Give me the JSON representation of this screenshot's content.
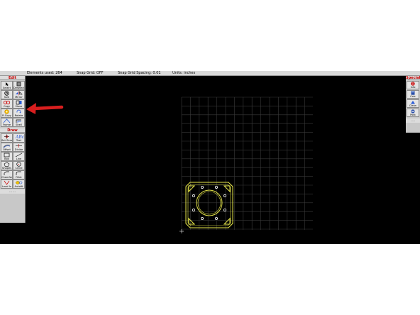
{
  "statusbar": {
    "elements_used": "Elements used: 264",
    "snap_grid": "Snap Grid: OFF",
    "snap_spacing": "Snap Grid Spacing: 0.01",
    "units": "Units: inches"
  },
  "left_toolbar": {
    "edit_header": "Edit",
    "draw_header": "Draw",
    "grip": "......",
    "edit_tools": [
      {
        "label": "Select",
        "icon": "cursor-icon"
      },
      {
        "label": "Deselect",
        "icon": "deselect-icon"
      },
      {
        "label": "Size",
        "icon": "size-icon"
      },
      {
        "label": "Mirror",
        "icon": "mirror-icon"
      },
      {
        "label": "Copy",
        "icon": "copy-icon"
      },
      {
        "label": "Move",
        "icon": "move-icon"
      },
      {
        "label": "R-Copy",
        "icon": "rotate-copy-icon"
      },
      {
        "label": "Rotate",
        "icon": "rotate-icon"
      },
      {
        "label": "Frame",
        "icon": "frame-icon"
      },
      {
        "label": "Shell",
        "icon": "shell-icon"
      }
    ],
    "draw_tools": [
      {
        "label": "Set Zero",
        "icon": "set-zero-icon"
      },
      {
        "label": "Text",
        "icon": "text-icon"
      },
      {
        "label": "Offset",
        "icon": "offset-icon"
      },
      {
        "label": "Divide",
        "icon": "divide-icon"
      },
      {
        "label": "Box",
        "icon": "box-icon"
      },
      {
        "label": "Line",
        "icon": "line-icon"
      },
      {
        "label": "Shapes",
        "icon": "shapes-icon"
      },
      {
        "label": "Circle",
        "icon": "circle-icon"
      },
      {
        "label": "Chamfer",
        "icon": "chamfer-icon"
      },
      {
        "label": "Fillet",
        "icon": "fillet-icon"
      },
      {
        "label": "Lead In",
        "icon": "lead-in-icon"
      },
      {
        "label": "Autofit",
        "icon": "autofit-icon"
      }
    ]
  },
  "right_toolbar": {
    "header": "Special",
    "grip": "....",
    "tools": [
      {
        "label": "Info",
        "icon": "info-icon"
      },
      {
        "label": "Calc",
        "icon": "calculator-icon"
      },
      {
        "label": "Clean",
        "icon": "clean-icon"
      },
      {
        "label": "Post",
        "icon": "post-icon"
      }
    ]
  },
  "colors": {
    "canvas": "#000000",
    "grid": "#3a3a3a",
    "part": "#e8e84a",
    "annotation_arrow": "#d81e1e",
    "header_text": "#c40000"
  }
}
